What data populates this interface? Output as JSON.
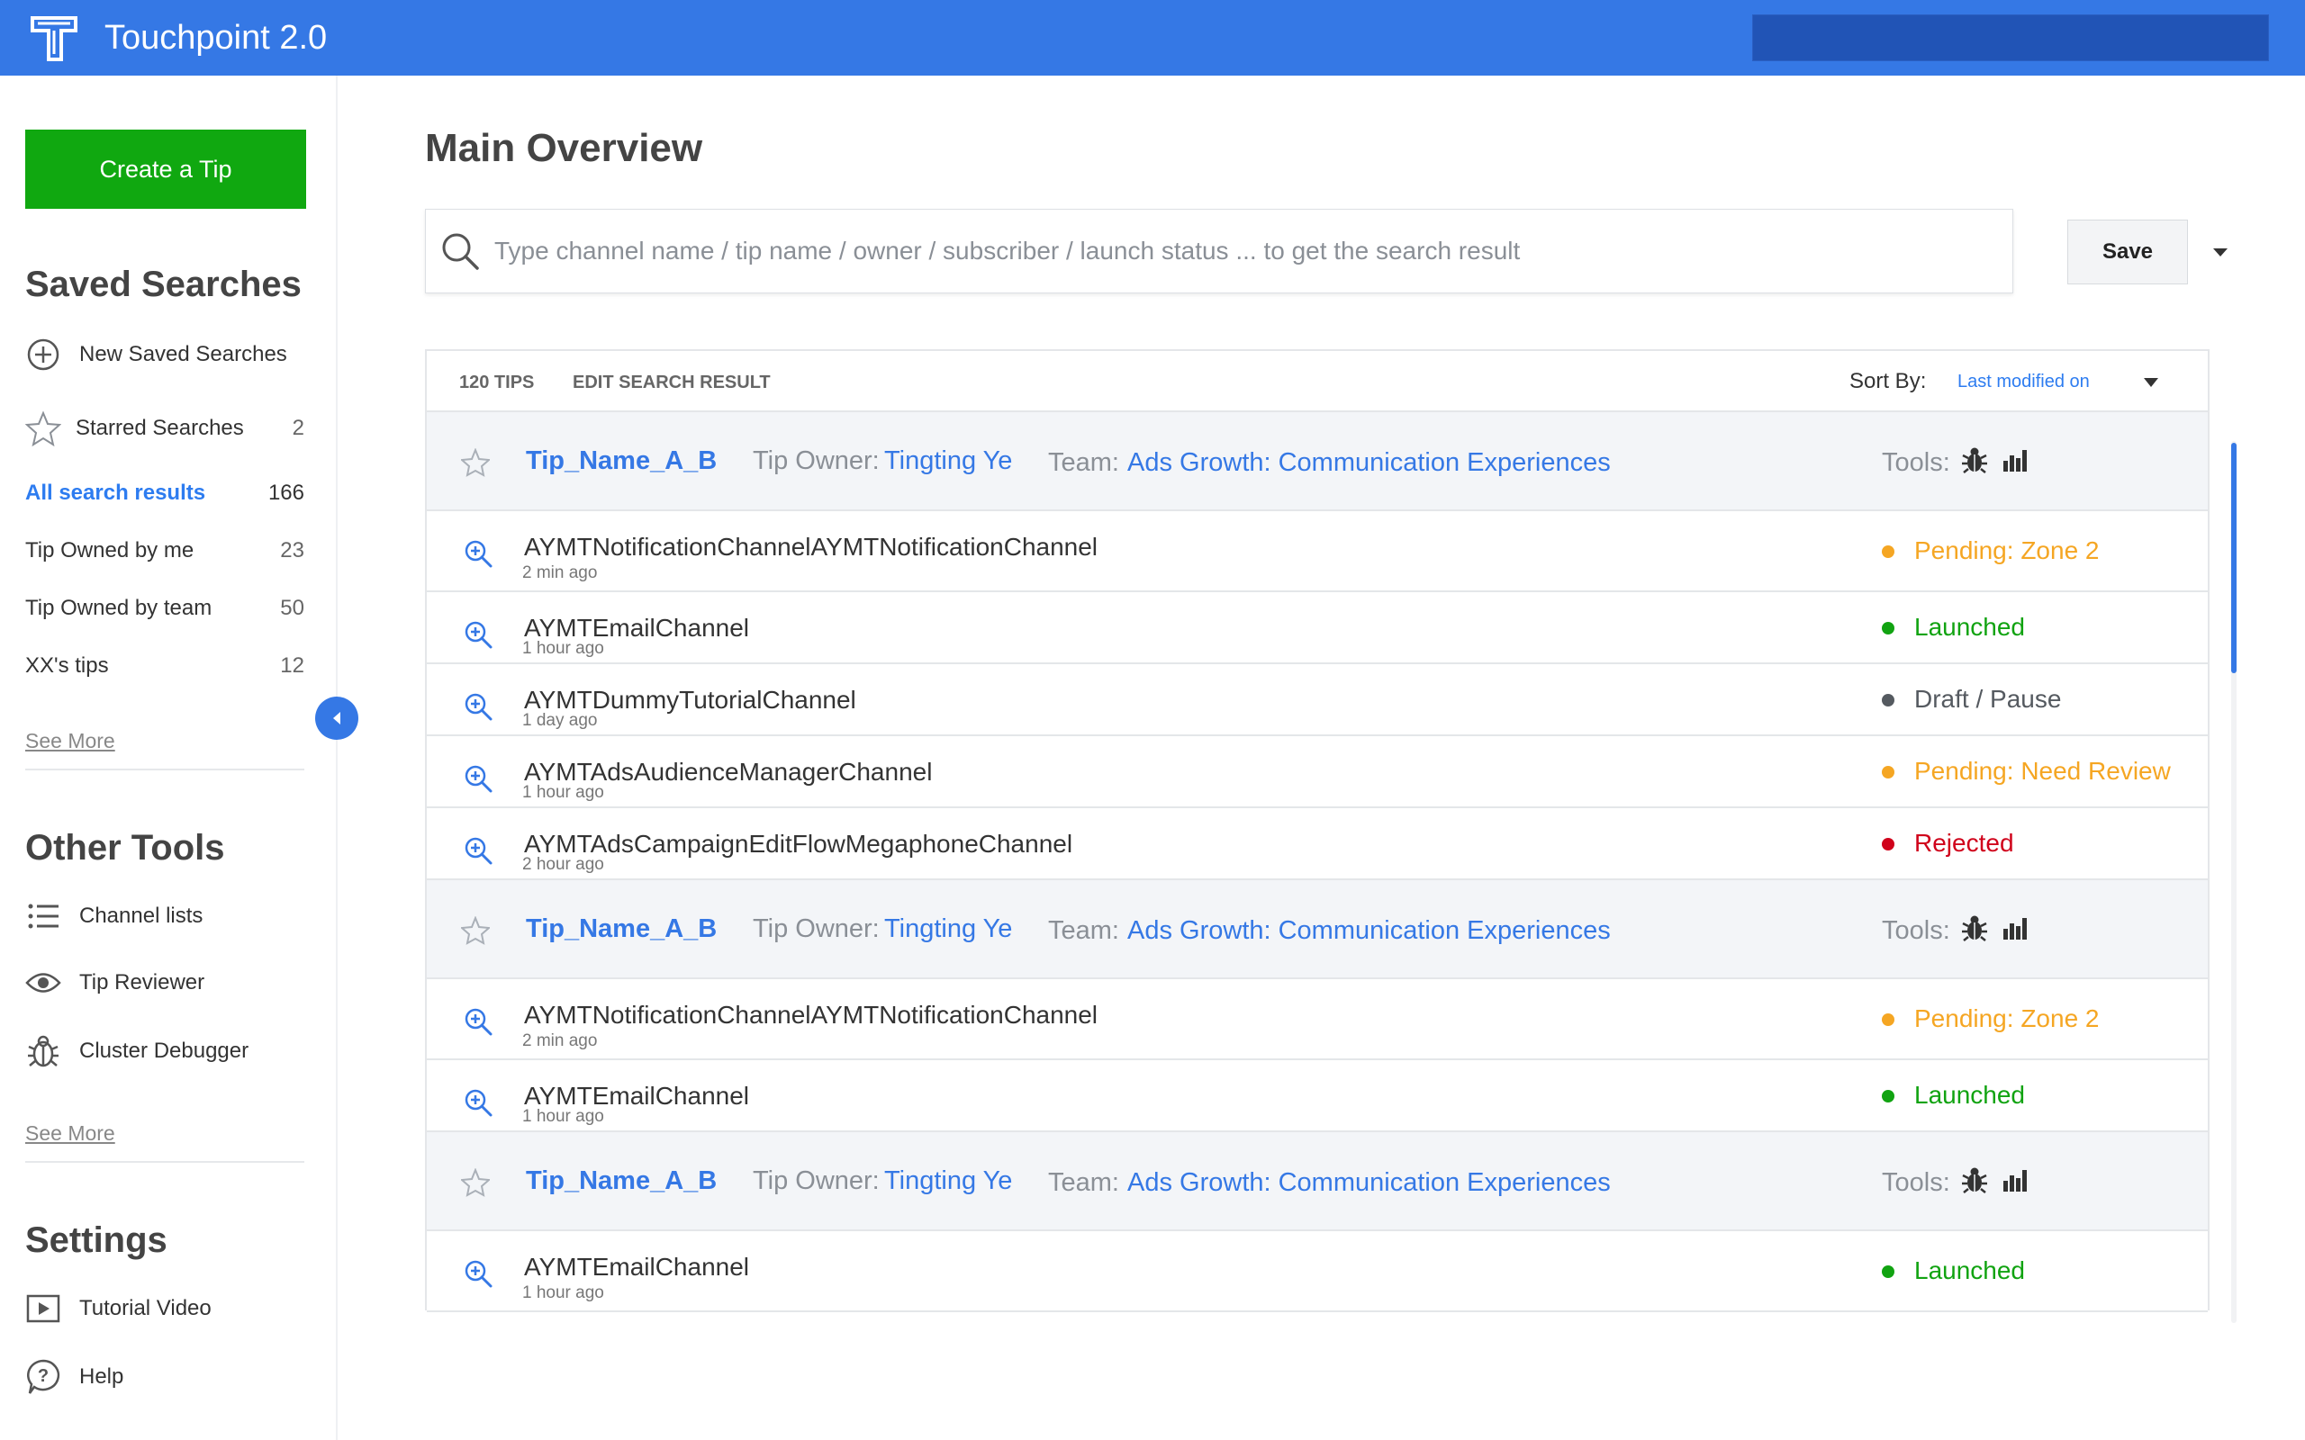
{
  "header": {
    "app_title": "Touchpoint 2.0"
  },
  "sidebar": {
    "create_label": "Create a Tip",
    "saved_searches": {
      "heading": "Saved Searches",
      "new_label": "New Saved Searches",
      "starred": {
        "label": "Starred Searches",
        "count": "2"
      },
      "items": [
        {
          "label": "All search results",
          "count": "166"
        },
        {
          "label": "Tip Owned by me",
          "count": "23"
        },
        {
          "label": "Tip Owned by team",
          "count": "50"
        },
        {
          "label": "XX's tips",
          "count": "12"
        }
      ],
      "see_more": "See More"
    },
    "other_tools": {
      "heading": "Other Tools",
      "items": [
        {
          "label": "Channel lists",
          "icon": "list-icon"
        },
        {
          "label": "Tip Reviewer",
          "icon": "eye-icon"
        },
        {
          "label": "Cluster Debugger",
          "icon": "bug-icon"
        }
      ],
      "see_more": "See More"
    },
    "settings": {
      "heading": "Settings",
      "items": [
        {
          "label": "Tutorial Video",
          "icon": "play-icon"
        },
        {
          "label": "Help",
          "icon": "help-icon"
        }
      ]
    }
  },
  "main": {
    "title": "Main Overview",
    "search_placeholder": "Type channel name / tip name / owner / subscriber / launch status ... to get the search result",
    "save_label": "Save",
    "results": {
      "count_label": "120 TIPS",
      "edit_label": "EDIT SEARCH RESULT",
      "sort_label": "Sort By:",
      "sort_value": "Last modified on"
    },
    "groups": [
      {
        "tip_name": "Tip_Name_A_B",
        "owner_label": "Tip Owner:",
        "owner": "Tingting Ye",
        "team_label": "Team:",
        "team": "Ads Growth: Communication Experiences",
        "tools_label": "Tools:",
        "channels": [
          {
            "name": "AYMTNotificationChannelAYMTNotificationChannel",
            "time": "2 min ago",
            "status": "Pending: Zone 2",
            "status_color": "#f5a623"
          },
          {
            "name": "AYMTEmailChannel",
            "time": "1 hour ago",
            "status": "Launched",
            "status_color": "#11a311"
          },
          {
            "name": "AYMTDummyTutorialChannel",
            "time": "1 day ago",
            "status": "Draft / Pause",
            "status_color": "#555a60"
          },
          {
            "name": "AYMTAdsAudienceManagerChannel",
            "time": "1 hour ago",
            "status": "Pending: Need Review",
            "status_color": "#f5a623"
          },
          {
            "name": "AYMTAdsCampaignEditFlowMegaphoneChannel",
            "time": "2 hour ago",
            "status": "Rejected",
            "status_color": "#d0021b"
          }
        ]
      },
      {
        "tip_name": "Tip_Name_A_B",
        "owner_label": "Tip Owner:",
        "owner": "Tingting Ye",
        "team_label": "Team:",
        "team": "Ads Growth: Communication Experiences",
        "tools_label": "Tools:",
        "channels": [
          {
            "name": "AYMTNotificationChannelAYMTNotificationChannel",
            "time": "2 min ago",
            "status": "Pending: Zone 2",
            "status_color": "#f5a623"
          },
          {
            "name": "AYMTEmailChannel",
            "time": "1 hour ago",
            "status": "Launched",
            "status_color": "#11a311"
          }
        ]
      },
      {
        "tip_name": "Tip_Name_A_B",
        "owner_label": "Tip Owner:",
        "owner": "Tingting Ye",
        "team_label": "Team:",
        "team": "Ads Growth: Communication Experiences",
        "tools_label": "Tools:",
        "channels": [
          {
            "name": "AYMTEmailChannel",
            "time": "1 hour ago",
            "status": "Launched",
            "status_color": "#11a311"
          }
        ]
      }
    ]
  },
  "colors": {
    "brand": "#3578e5",
    "create": "#10a810",
    "link": "#3578e5"
  }
}
